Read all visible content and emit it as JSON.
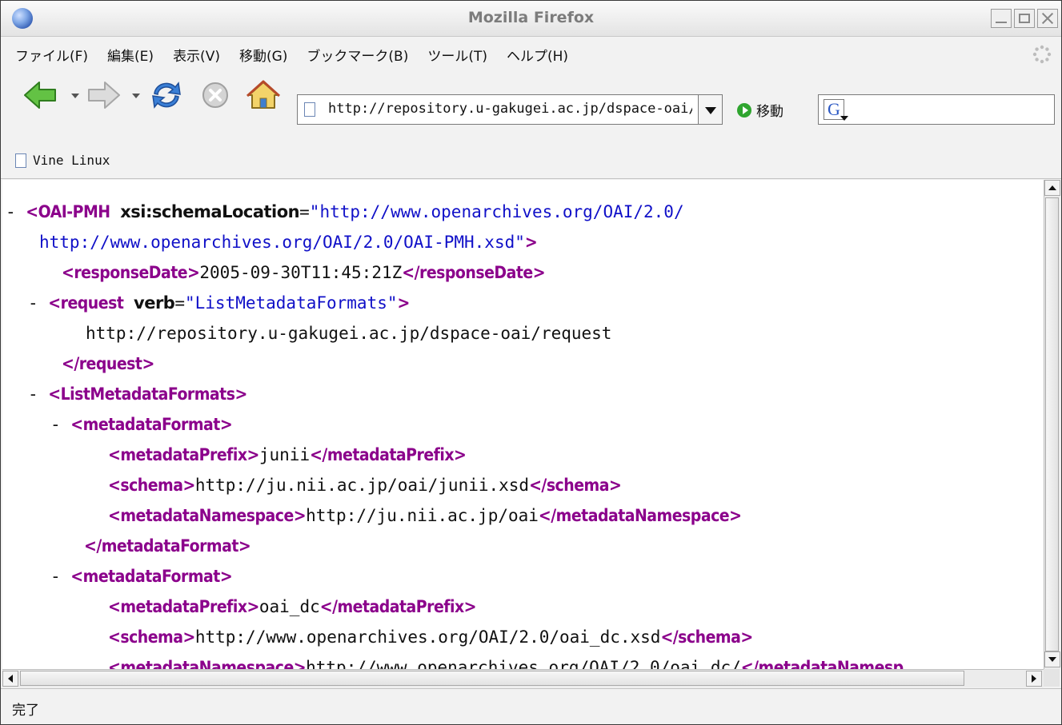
{
  "window": {
    "title": "Mozilla Firefox"
  },
  "menu": [
    "ファイル(F)",
    "編集(E)",
    "表示(V)",
    "移動(G)",
    "ブックマーク(B)",
    "ツール(T)",
    "ヘルプ(H)"
  ],
  "navbar": {
    "url": "http://repository.u-gakugei.ac.jp/dspace-oai/request?verb=ListMetadataFormats",
    "go_label": "移動",
    "search_value": ""
  },
  "bookmarks": [
    "Vine Linux"
  ],
  "xml": {
    "l1_tag": "OAI-PMH",
    "l1_attr": "xsi:schemaLocation",
    "l1_val": "\"http://www.openarchives.org/OAI/2.0/",
    "l2_val": "http://www.openarchives.org/OAI/2.0/OAI-PMH.xsd\"",
    "response_tag": "responseDate",
    "response_text": "2005-09-30T11:45:21Z",
    "request_tag": "request",
    "request_attr": "verb",
    "request_val": "\"ListMetadataFormats\"",
    "request_text": "http://repository.u-gakugei.ac.jp/dspace-oai/request",
    "lmf_tag": "ListMetadataFormats",
    "mf_tag": "metadataFormat",
    "prefix_tag": "metadataPrefix",
    "schema_tag": "schema",
    "ns_tag": "metadataNamespace",
    "mf1_prefix": "junii",
    "mf1_schema": "http://ju.nii.ac.jp/oai/junii.xsd",
    "mf1_ns": "http://ju.nii.ac.jp/oai",
    "mf2_prefix": "oai_dc",
    "mf2_schema": "http://www.openarchives.org/OAI/2.0/oai_dc.xsd",
    "mf2_ns": "http://www.openarchives.org/OAI/2.0/oai_dc/",
    "ns_tag_cut": "metadataNamesp"
  },
  "status": {
    "text": "完了"
  }
}
